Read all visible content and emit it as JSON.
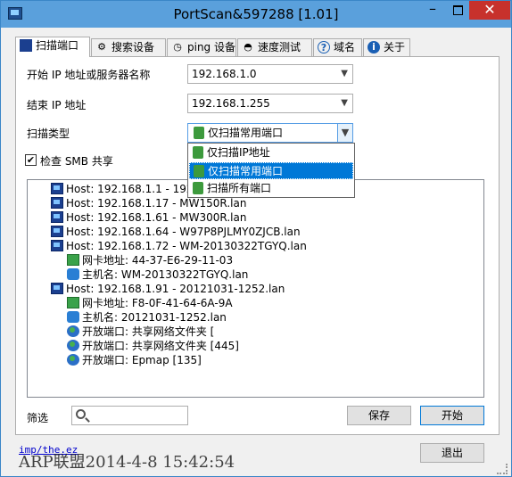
{
  "window": {
    "title": "PortScan&597288 [1.01]"
  },
  "tabs": [
    {
      "label": "扫描端口",
      "icon": "computer-icon"
    },
    {
      "label": "搜索设备",
      "icon": "search-devices-icon"
    },
    {
      "label": "ping 设备",
      "icon": "ping-icon"
    },
    {
      "label": "速度测试",
      "icon": "speedometer-icon"
    },
    {
      "label": "域名",
      "icon": "help-icon"
    },
    {
      "label": "关于",
      "icon": "info-icon"
    }
  ],
  "form": {
    "start_ip_label": "开始 IP 地址或服务器名称",
    "start_ip_value": "192.168.1.0",
    "end_ip_label": "结束 IP 地址",
    "end_ip_value": "192.168.1.255",
    "scan_type_label": "扫描类型",
    "scan_type_value": "仅扫描常用端口",
    "smb_label": "检查 SMB 共享",
    "smb_checked": "✔"
  },
  "scan_type_options": [
    {
      "label": "仅扫描IP地址"
    },
    {
      "label": "仅扫描常用端口"
    },
    {
      "label": "扫描所有端口"
    }
  ],
  "results": [
    {
      "text": "Host: 192.168.1.1 - 192.168.",
      "icon": "computer-icon",
      "level": 0
    },
    {
      "text": "Host: 192.168.1.17 - MW150R.lan",
      "icon": "computer-icon",
      "level": 0
    },
    {
      "text": "Host: 192.168.1.61 - MW300R.lan",
      "icon": "computer-icon",
      "level": 0
    },
    {
      "text": "Host: 192.168.1.64 - W97P8PJLMY0ZJCB.lan",
      "icon": "computer-icon",
      "level": 0
    },
    {
      "text": "Host: 192.168.1.72 - WM-20130322TGYQ.lan",
      "icon": "computer-icon",
      "level": 0
    },
    {
      "text": "网卡地址: 44-37-E6-29-11-03",
      "icon": "network-card-icon",
      "level": 1
    },
    {
      "text": "主机名: WM-20130322TGYQ.lan",
      "icon": "hostname-icon",
      "level": 1
    },
    {
      "text": "Host: 192.168.1.91 - 20121031-1252.lan",
      "icon": "computer-icon",
      "level": 0
    },
    {
      "text": "网卡地址: F8-0F-41-64-6A-9A",
      "icon": "network-card-icon",
      "level": 1
    },
    {
      "text": "主机名: 20121031-1252.lan",
      "icon": "hostname-icon",
      "level": 1
    },
    {
      "text": "开放端口: 共享网络文件夹 [",
      "icon": "globe-icon",
      "level": 1
    },
    {
      "text": "开放端口: 共享网络文件夹 [445]",
      "icon": "globe-icon",
      "level": 1
    },
    {
      "text": "开放端口: Epmap [135]",
      "icon": "globe-icon",
      "level": 1
    }
  ],
  "bottom": {
    "filter_label": "筛选",
    "filter_value": "",
    "save_label": "保存",
    "start_label": "开始",
    "exit_label": "退出",
    "status_link": "imp/the.ez",
    "watermark": "ARP联盟2014-4-8 15:42:54"
  }
}
